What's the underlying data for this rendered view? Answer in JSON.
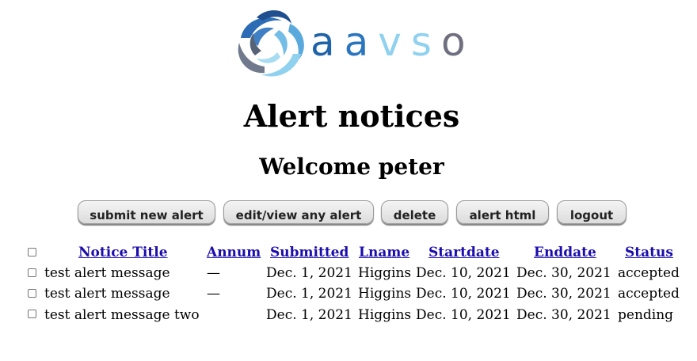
{
  "logo": {
    "letters": [
      "a",
      "a",
      "v",
      "s",
      "o"
    ],
    "letter_colors": [
      "#1f63a8",
      "#2a76be",
      "#8fd1ee",
      "#8fd1ee",
      "#6f6f80"
    ]
  },
  "page": {
    "title": "Alert notices",
    "welcome": "Welcome peter"
  },
  "toolbar": {
    "submit_label": "submit new alert",
    "edit_label": "edit/view any alert",
    "delete_label": "delete",
    "html_label": "alert html",
    "logout_label": "logout"
  },
  "table": {
    "headers": [
      "Notice Title",
      "Annum",
      "Submitted",
      "Lname",
      "Startdate",
      "Enddate",
      "Status"
    ],
    "rows": [
      {
        "title": "test alert message",
        "annum": "—",
        "submitted": "Dec. 1, 2021",
        "lname": "Higgins",
        "startdate": "Dec. 10, 2021",
        "enddate": "Dec. 30, 2021",
        "status": "accepted"
      },
      {
        "title": "test alert message",
        "annum": "—",
        "submitted": "Dec. 1, 2021",
        "lname": "Higgins",
        "startdate": "Dec. 10, 2021",
        "enddate": "Dec. 30, 2021",
        "status": "accepted"
      },
      {
        "title": "test alert message two",
        "annum": "",
        "submitted": "Dec. 1, 2021",
        "lname": "Higgins",
        "startdate": "Dec. 10, 2021",
        "enddate": "Dec. 30, 2021",
        "status": "pending"
      }
    ]
  }
}
